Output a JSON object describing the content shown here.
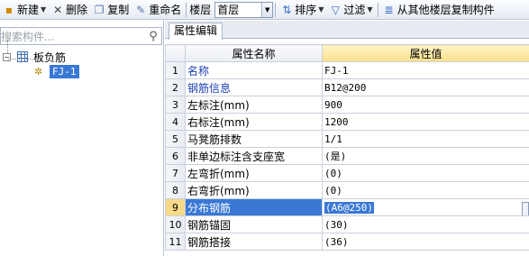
{
  "toolbar": {
    "new_label": "新建",
    "delete_label": "删除",
    "copy_label": "复制",
    "rename_label": "重命名",
    "floor_label": "楼层",
    "floor_value": "首层",
    "sort_label": "排序",
    "filter_label": "过滤",
    "copy_from_floor_label": "从其他楼层复制构件"
  },
  "search": {
    "placeholder": "搜索构件..."
  },
  "tree": {
    "root_label": "板负筋",
    "child_label": "FJ-1"
  },
  "panel": {
    "tab_label": "属性编辑",
    "col_name": "属性名称",
    "col_value": "属性值",
    "rows": [
      {
        "num": "1",
        "name": "名称",
        "value": "FJ-1"
      },
      {
        "num": "2",
        "name": "钢筋信息",
        "value": "B12@200"
      },
      {
        "num": "3",
        "name": "左标注(mm)",
        "value": "900"
      },
      {
        "num": "4",
        "name": "右标注(mm)",
        "value": "1200"
      },
      {
        "num": "5",
        "name": "马凳筋排数",
        "value": "1/1"
      },
      {
        "num": "6",
        "name": "非单边标注含支座宽",
        "value": "(是)"
      },
      {
        "num": "7",
        "name": "左弯折(mm)",
        "value": "(0)"
      },
      {
        "num": "8",
        "name": "右弯折(mm)",
        "value": "(0)"
      },
      {
        "num": "9",
        "name": "分布钢筋",
        "value": "(A6@250)"
      },
      {
        "num": "10",
        "name": "钢筋锚固",
        "value": "(30)"
      },
      {
        "num": "11",
        "name": "钢筋搭接",
        "value": "(36)"
      }
    ]
  }
}
